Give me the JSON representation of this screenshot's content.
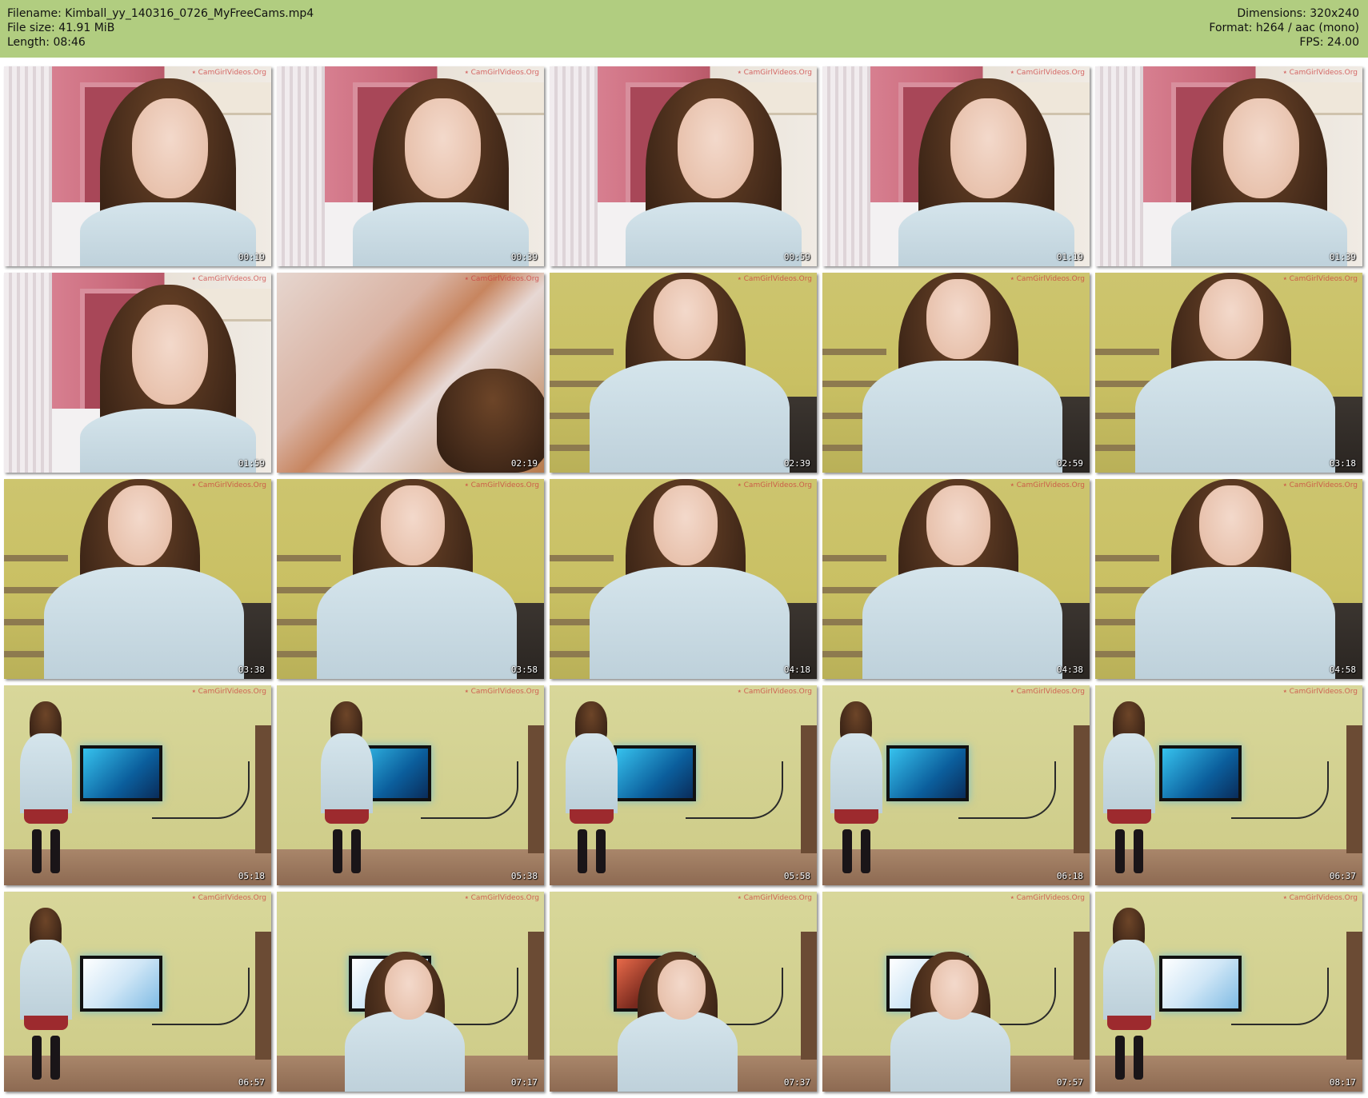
{
  "header": {
    "filename_line": "Filename: Kimball_yy_140316_0726_MyFreeCams.mp4",
    "filesize_line": "File size: 41.91 MiB",
    "length_line": "Length: 08:46",
    "dimensions_line": "Dimensions: 320x240",
    "format_line": "Format: h264 / aac (mono)",
    "fps_line": "FPS: 24.00",
    "background_color": "#b1cd80"
  },
  "thumbnails": [
    {
      "time": "00:19",
      "scene": "pink"
    },
    {
      "time": "00:39",
      "scene": "pink"
    },
    {
      "time": "00:59",
      "scene": "pink"
    },
    {
      "time": "01:19",
      "scene": "pink"
    },
    {
      "time": "01:39",
      "scene": "pink"
    },
    {
      "time": "01:59",
      "scene": "pink"
    },
    {
      "time": "02:19",
      "scene": "blur"
    },
    {
      "time": "02:39",
      "scene": "yellow"
    },
    {
      "time": "02:59",
      "scene": "yellow"
    },
    {
      "time": "03:18",
      "scene": "yellow"
    },
    {
      "time": "03:38",
      "scene": "yellow"
    },
    {
      "time": "03:58",
      "scene": "yellow"
    },
    {
      "time": "04:18",
      "scene": "yellow"
    },
    {
      "time": "04:38",
      "scene": "yellow"
    },
    {
      "time": "04:58",
      "scene": "yellow"
    },
    {
      "time": "05:18",
      "scene": "room"
    },
    {
      "time": "05:38",
      "scene": "room"
    },
    {
      "time": "05:58",
      "scene": "room"
    },
    {
      "time": "06:18",
      "scene": "room"
    },
    {
      "time": "06:37",
      "scene": "room"
    },
    {
      "time": "06:57",
      "scene": "room"
    },
    {
      "time": "07:17",
      "scene": "room"
    },
    {
      "time": "07:37",
      "scene": "room"
    },
    {
      "time": "07:57",
      "scene": "room"
    },
    {
      "time": "08:17",
      "scene": "room"
    }
  ]
}
